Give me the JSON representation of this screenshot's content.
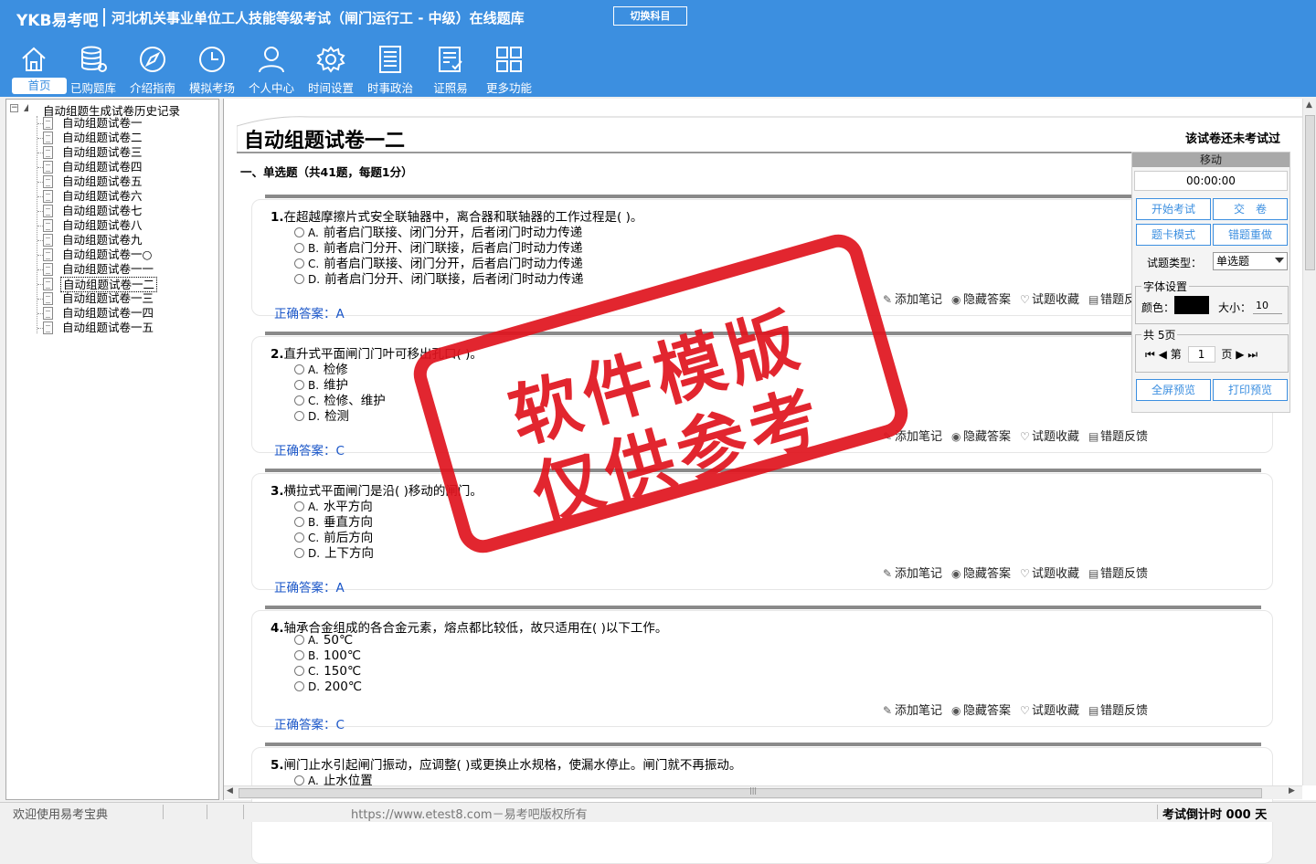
{
  "app": {
    "logo": "YKB易考吧",
    "title": "河北机关事业单位工人技能等级考试（闸门运行工 - 中级）在线题库",
    "switch_subject": "切换科目"
  },
  "nav": [
    {
      "label": "首页",
      "icon": "home-icon"
    },
    {
      "label": "已购题库",
      "icon": "database-icon"
    },
    {
      "label": "介绍指南",
      "icon": "compass-icon"
    },
    {
      "label": "模拟考场",
      "icon": "clock-icon"
    },
    {
      "label": "个人中心",
      "icon": "user-icon"
    },
    {
      "label": "时间设置",
      "icon": "gear-icon"
    },
    {
      "label": "时事政治",
      "icon": "news-icon"
    },
    {
      "label": "证照易",
      "icon": "certificate-icon"
    },
    {
      "label": "更多功能",
      "icon": "grid-icon"
    }
  ],
  "tree": {
    "root": "自动组题生成试卷历史记录",
    "items": [
      "自动组题试卷一",
      "自动组题试卷二",
      "自动组题试卷三",
      "自动组题试卷四",
      "自动组题试卷五",
      "自动组题试卷六",
      "自动组题试卷七",
      "自动组题试卷八",
      "自动组题试卷九",
      "自动组题试卷一○",
      "自动组题试卷一一",
      "自动组题试卷一二",
      "自动组题试卷一三",
      "自动组题试卷一四",
      "自动组题试卷一五"
    ],
    "selected_index": 11
  },
  "paper": {
    "title": "自动组题试卷一二",
    "status": "该试卷还未考试过",
    "section": "一、单选题（共41题，每题1分）"
  },
  "questions": [
    {
      "num": "1.",
      "stem": "在超越摩擦片式安全联轴器中，离合器和联轴器的工作过程是( )。",
      "options": [
        {
          "key": "A.",
          "text": "前者启门联接、闭门分开，后者闭门时动力传递"
        },
        {
          "key": "B.",
          "text": "前者启门分开、闭门联接，后者启门时动力传递"
        },
        {
          "key": "C.",
          "text": "前者启门联接、闭门分开，后者启门时动力传递"
        },
        {
          "key": "D.",
          "text": "前者启门分开、闭门联接，后者闭门时动力传递"
        }
      ],
      "answer": "正确答案：A"
    },
    {
      "num": "2.",
      "stem": "直升式平面闸门门叶可移出孔口( )。",
      "options": [
        {
          "key": "A.",
          "text": "检修"
        },
        {
          "key": "B.",
          "text": "维护"
        },
        {
          "key": "C.",
          "text": "检修、维护"
        },
        {
          "key": "D.",
          "text": "检测"
        }
      ],
      "answer": "正确答案：C"
    },
    {
      "num": "3.",
      "stem": "横拉式平面闸门是沿( )移动的闸门。",
      "options": [
        {
          "key": "A.",
          "text": "水平方向"
        },
        {
          "key": "B.",
          "text": "垂直方向"
        },
        {
          "key": "C.",
          "text": "前后方向"
        },
        {
          "key": "D.",
          "text": "上下方向"
        }
      ],
      "answer": "正确答案：A"
    },
    {
      "num": "4.",
      "stem": "轴承合金组成的各合金元素，熔点都比较低，故只适用在( )以下工作。",
      "options": [
        {
          "key": "A.",
          "text": "50℃"
        },
        {
          "key": "B.",
          "text": "100℃"
        },
        {
          "key": "C.",
          "text": "150℃"
        },
        {
          "key": "D.",
          "text": "200℃"
        }
      ],
      "answer": "正确答案：C"
    },
    {
      "num": "5.",
      "stem": "闸门止水引起闸门振动，应调整( )或更换止水规格，使漏水停止。闸门就不再振动。",
      "options": [
        {
          "key": "A.",
          "text": "止水位置"
        }
      ],
      "answer": ""
    }
  ],
  "actions": {
    "note": "添加笔记",
    "hide": "隐藏答案",
    "fav": "试题收藏",
    "feedback": "错题反馈"
  },
  "control": {
    "move": "移动",
    "timer": "00:00:00",
    "start": "开始考试",
    "submit": "交　卷",
    "card_mode": "题卡模式",
    "redo_wrong": "错题重做",
    "type_label": "试题类型：",
    "type_value": "单选题",
    "font_legend": "字体设置",
    "color_label": "颜色：",
    "font_color": "#000000",
    "size_label": "大小：",
    "size_value": "10",
    "pages_legend": "共 5页",
    "page_prefix": "第",
    "page_value": "1",
    "page_suffix": "页",
    "fullscreen": "全屏预览",
    "print": "打印预览"
  },
  "statusbar": {
    "welcome": "欢迎使用易考宝典",
    "url": "https://www.etest8.com－易考吧版权所有",
    "countdown": "考试倒计时 000 天"
  },
  "watermark": {
    "line1": "软件模版",
    "line2": "仅供参考",
    "color": "#e0141e"
  }
}
